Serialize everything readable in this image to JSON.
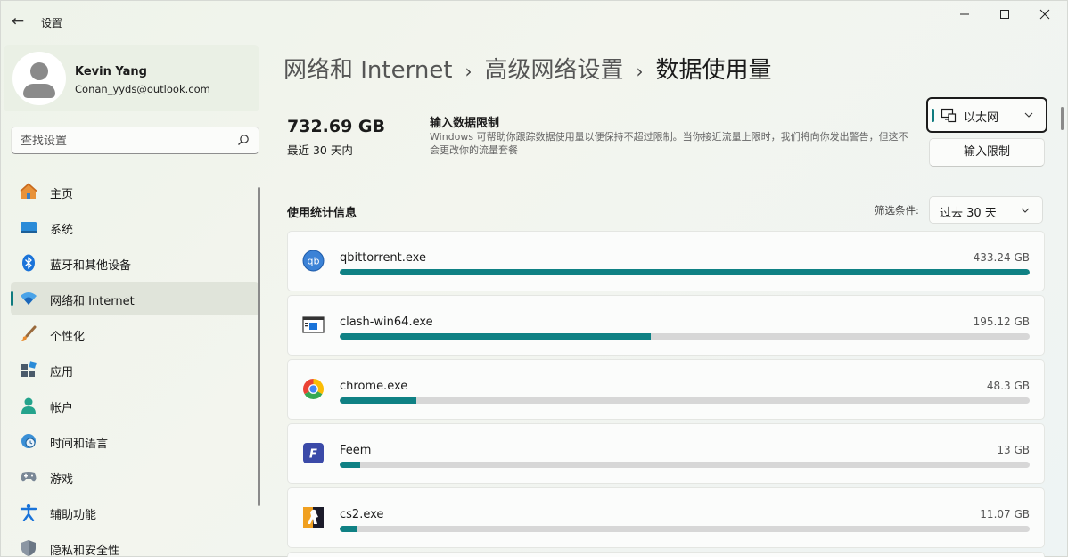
{
  "titlebar": {
    "back_label": "←",
    "app_title": "设置",
    "minimize": "—",
    "maximize": "☐",
    "close": "✕"
  },
  "profile": {
    "name": "Kevin Yang",
    "email": "Conan_yyds@outlook.com"
  },
  "search": {
    "placeholder": "查找设置",
    "value": ""
  },
  "nav": {
    "items": [
      {
        "label": "主页",
        "icon": "home-icon",
        "active": false
      },
      {
        "label": "系统",
        "icon": "monitor-icon",
        "active": false
      },
      {
        "label": "蓝牙和其他设备",
        "icon": "bluetooth-icon",
        "active": false
      },
      {
        "label": "网络和 Internet",
        "icon": "wifi-icon",
        "active": true
      },
      {
        "label": "个性化",
        "icon": "brush-icon",
        "active": false
      },
      {
        "label": "应用",
        "icon": "apps-icon",
        "active": false
      },
      {
        "label": "帐户",
        "icon": "account-icon",
        "active": false
      },
      {
        "label": "时间和语言",
        "icon": "clock-globe-icon",
        "active": false
      },
      {
        "label": "游戏",
        "icon": "gamepad-icon",
        "active": false
      },
      {
        "label": "辅助功能",
        "icon": "accessibility-icon",
        "active": false
      },
      {
        "label": "隐私和安全性",
        "icon": "shield-icon",
        "active": false
      }
    ]
  },
  "breadcrumb": {
    "items": [
      "网络和 Internet",
      "高级网络设置"
    ],
    "separator": "›",
    "current": "数据使用量"
  },
  "summary": {
    "total": "732.69 GB",
    "period": "最近 30 天内"
  },
  "limit": {
    "title": "输入数据限制",
    "description": "Windows 可帮助你跟踪数据使用量以便保持不超过限制。当你接近流量上限时，我们将向你发出警告，但这不会更改你的流量套餐",
    "button_label": "输入限制"
  },
  "adapter": {
    "selected": "以太网"
  },
  "stats": {
    "title": "使用统计信息",
    "filter_label": "筛选条件:",
    "filter_value": "过去 30 天"
  },
  "usage": [
    {
      "name": "qbittorrent.exe",
      "usage": "433.24 GB",
      "fraction": 1.0,
      "icon": "qbittorrent-icon"
    },
    {
      "name": "clash-win64.exe",
      "usage": "195.12 GB",
      "fraction": 0.4504,
      "icon": "clash-icon"
    },
    {
      "name": "chrome.exe",
      "usage": "48.3 GB",
      "fraction": 0.1115,
      "icon": "chrome-icon"
    },
    {
      "name": "Feem",
      "usage": "13 GB",
      "fraction": 0.03,
      "icon": "feem-icon"
    },
    {
      "name": "cs2.exe",
      "usage": "11.07 GB",
      "fraction": 0.0256,
      "icon": "cs2-icon"
    }
  ],
  "colors": {
    "accent": "#0f8184",
    "bar_track": "#d7d7d7"
  }
}
